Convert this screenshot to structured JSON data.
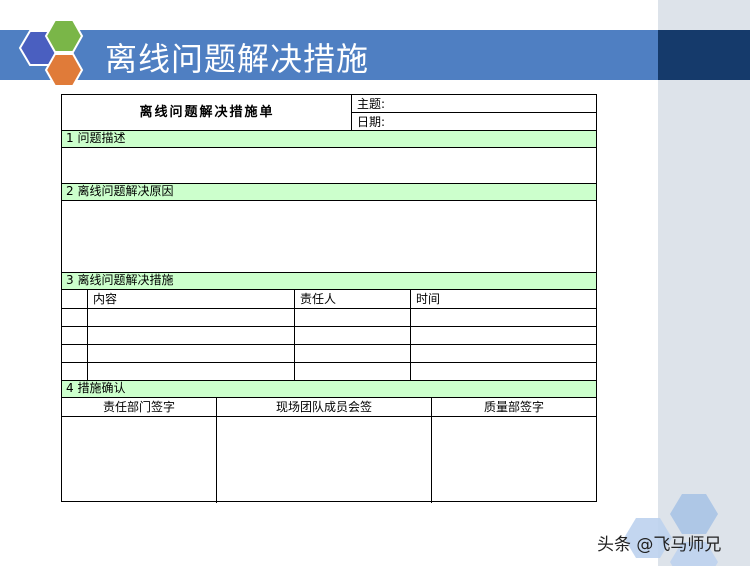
{
  "slide": {
    "title": "离线问题解决措施"
  },
  "form": {
    "title": "离线问题解决措施单",
    "subject_label": "主题:",
    "date_label": "日期:",
    "sections": [
      {
        "label": "1  问题描述"
      },
      {
        "label": "2  离线问题解决原因"
      },
      {
        "label": "3  离线问题解决措施"
      },
      {
        "label": "4  措施确认"
      }
    ],
    "measures_columns": [
      "内容",
      "责任人",
      "时间"
    ],
    "confirm_columns": [
      "责任部门签字",
      "现场团队成员会签",
      "质量部签字"
    ]
  },
  "watermark": "头条 @飞马师兄",
  "colors": {
    "title_bar": "#4f7fc2",
    "title_bar_dark": "#153a6b",
    "section_fill": "#ccffcc",
    "hex_blue": "#4a5fc0",
    "hex_green": "#7ab648",
    "hex_orange": "#e07b39"
  }
}
